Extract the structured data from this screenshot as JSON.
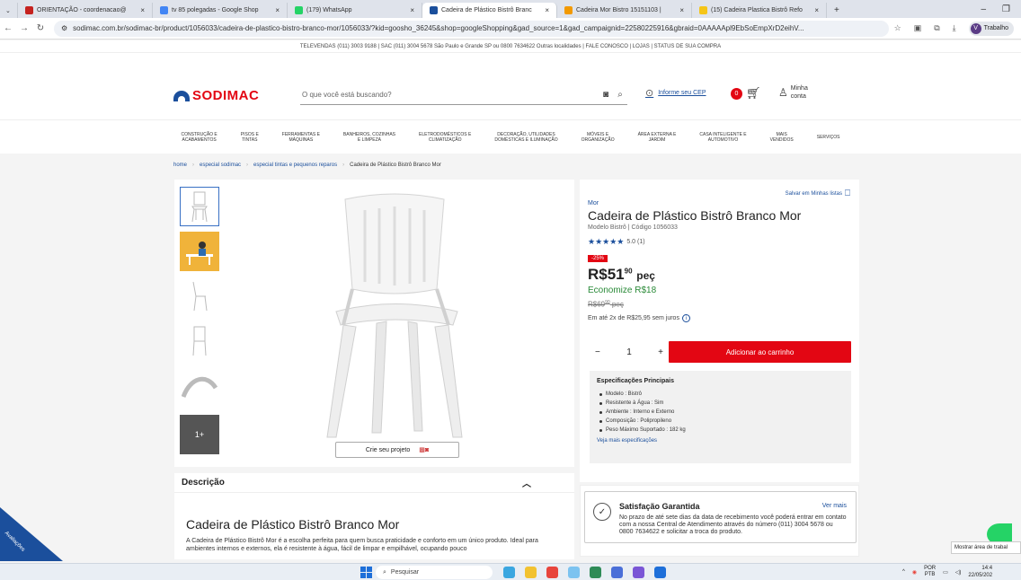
{
  "browser": {
    "tabs": [
      {
        "label": "ORIENTAÇÃO - coordenacao@",
        "color": "#c5221f"
      },
      {
        "label": "tv 85 polegadas - Google Shop",
        "color": "#4285f4"
      },
      {
        "label": "(179) WhatsApp",
        "color": "#25d366"
      },
      {
        "label": "Cadeira de Plástico Bistrô Branc",
        "color": "#1b4f9c",
        "active": true
      },
      {
        "label": "Cadeira Mor Bistro 15151103 |",
        "color": "#f29900"
      },
      {
        "label": "(15) Cadeira Plastica Bistrô Refo",
        "color": "#f5c518"
      }
    ],
    "url": "sodimac.com.br/sodimac-br/product/1056033/cadeira-de-plastico-bistro-branco-mor/1056033/?kid=goosho_36245&shop=googleShopping&gad_source=1&gad_campaignid=22580225916&gbraid=0AAAAApl9EbSoEmpXrD2eihV...",
    "profile_label": "Trabalho",
    "profile_initial": "V"
  },
  "topinfo": "TELEVENDAS (011) 3003 9188 | SAC (011) 3004 5678 São Paulo e Grande SP ou 0800 7634622 Outras localidades | FALE CONOSCO | LOJAS | STATUS DE SUA COMPRA",
  "header": {
    "logo": "SODIMAC",
    "search_placeholder": "O que você está buscando?",
    "cep_label": "Informe seu CEP",
    "cart_count": "0",
    "account_line1": "Minha",
    "account_line2": "conta"
  },
  "categories": [
    [
      "CONSTRUÇÃO E",
      "ACABAMENTOS"
    ],
    [
      "PISOS E",
      "TINTAS"
    ],
    [
      "FERRAMENTAS E",
      "MÁQUINAS"
    ],
    [
      "BANHEIROS, COZINHAS",
      "E LIMPEZA"
    ],
    [
      "ELETRODOMÉSTICOS E",
      "CLIMATIZAÇÃO"
    ],
    [
      "DECORAÇÃO, UTILIDADES",
      "DOMÉSTICAS E ILUMINAÇÃO"
    ],
    [
      "MÓVEIS E",
      "ORGANIZAÇÃO"
    ],
    [
      "ÁREA EXTERNA E",
      "JARDIM"
    ],
    [
      "CASA INTELIGENTE E",
      "AUTOMOTIVO"
    ],
    [
      "MAIS",
      "VENDIDOS"
    ],
    [
      "SERVIÇOS",
      ""
    ]
  ],
  "breadcrumb": {
    "items": [
      "home",
      "especial sodimac",
      "especial tintas e pequenos reparos"
    ],
    "current": "Cadeira de Plástico Bistrô Branco Mor"
  },
  "gallery": {
    "more_label": "1+",
    "project_button": "Crie seu projeto"
  },
  "description": {
    "header": "Descrição",
    "title": "Cadeira de Plástico Bistrô Branco Mor",
    "text": "A Cadeira de Plástico Bistrô Mor é a escolha perfeita para quem busca praticidade e conforto em um único produto. Ideal para ambientes internos e externos, ela é resistente à água, fácil de limpar e empilhável, ocupando pouco"
  },
  "product": {
    "save_label": "Salvar em Minhas listas",
    "brand": "Mor",
    "title": "Cadeira de Plástico Bistrô Branco Mor",
    "meta": "Modelo Bistrô  |  Código 1056033",
    "stars": "★★★★★",
    "rating": "5.0 (1)",
    "discount": "-25%",
    "price_int": "R$51",
    "price_cents": "90",
    "price_unit": "peç",
    "economize": "Economize R$18",
    "old_price_int": "R$69",
    "old_price_cents": "90",
    "old_unit": "peç",
    "installments": "Em até 2x de R$25,95 sem juros",
    "qty": "1",
    "add_to_cart": "Adicionar ao carrinho",
    "specs_title": "Especificações Principais",
    "specs": [
      "Modelo : Bistrô",
      "Resistente à Água : Sim",
      "Ambiente : Interno e Externo",
      "Composição : Polipropileno",
      "Peso Máximo Suportado : 182 kg"
    ],
    "specs_more": "Veja mais especificações"
  },
  "satisfaction": {
    "title": "Satisfação Garantida",
    "link": "Ver mais",
    "text": "No prazo de até sete dias da data de recebimento você poderá entrar em contato com a nossa Central de Atendimento através do número (011) 3004 5678 ou 0800 7634622 e solicitar a troca do produto."
  },
  "reviews_tab": "Avaliações",
  "tooltip": "Mostrar área de trabal",
  "taskbar": {
    "search": "Pesquisar",
    "lang1": "POR",
    "lang2": "PTB",
    "time": "14:4",
    "date": "22/05/202"
  },
  "colors": {
    "brand_red": "#e30613",
    "brand_blue": "#1b4f9c",
    "save_green": "#2a8a38"
  }
}
